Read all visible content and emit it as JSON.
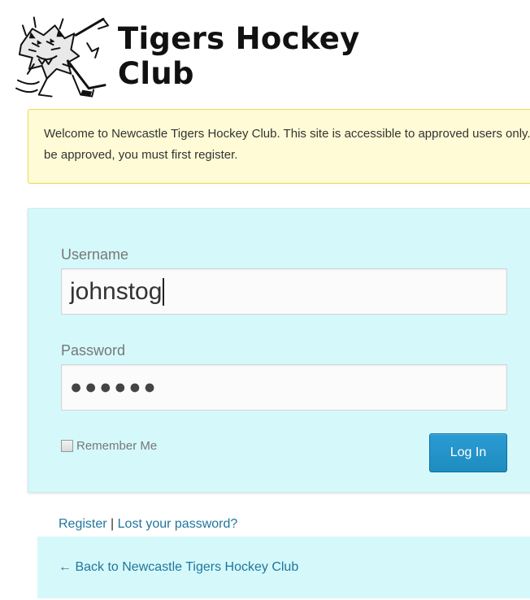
{
  "header": {
    "site_name": "Tigers Hockey Club",
    "logo_icon": "tiger-hockey-mascot-icon"
  },
  "notice": {
    "message": "Welcome to Newcastle Tigers Hockey Club. This site is accessible to approved users only. To be approved, you must first register."
  },
  "login_form": {
    "username_label": "Username",
    "username_value": "johnstog",
    "password_label": "Password",
    "password_masked": "●●●●●●",
    "remember_label": "Remember Me",
    "remember_checked": false,
    "submit_label": "Log In"
  },
  "links": {
    "register": "Register",
    "separator": "|",
    "lost_password": "Lost your password?",
    "back_to_site": "← Back to Newcastle Tigers Hockey Club"
  },
  "colors": {
    "panel_bg": "#d5f9fb",
    "notice_bg": "#fffbd6",
    "button_bg": "#1e8cbe",
    "link": "#21759b"
  }
}
